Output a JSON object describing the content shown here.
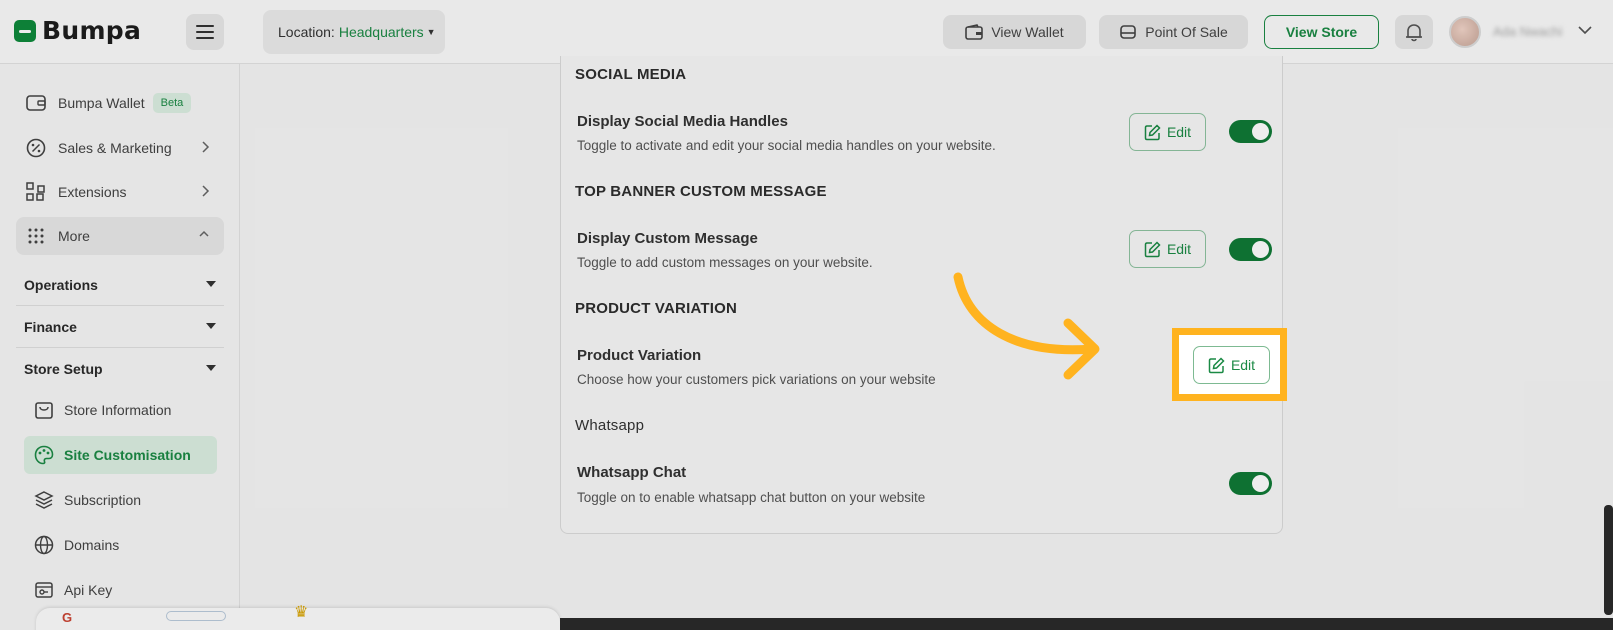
{
  "brand": {
    "name": "Bumpa",
    "accent": "#1b8a45",
    "highlight": "#ffb31f"
  },
  "header": {
    "location_label": "Location:",
    "location_value": "Headquarters",
    "view_wallet": "View Wallet",
    "point_of_sale": "Point Of Sale",
    "view_store": "View Store",
    "user_name": "Ada Nwachi",
    "icons": [
      "menu-icon",
      "wallet-icon",
      "pos-icon",
      "bell-icon",
      "chevron-down-icon"
    ]
  },
  "sidebar": {
    "items": [
      {
        "label": "Bumpa Wallet",
        "badge": "Beta",
        "icon": "wallet-icon"
      },
      {
        "label": "Sales & Marketing",
        "icon": "percent-icon"
      },
      {
        "label": "Extensions",
        "icon": "extensions-icon"
      },
      {
        "label": "More",
        "icon": "grid-icon"
      }
    ],
    "sections": [
      {
        "label": "Operations"
      },
      {
        "label": "Finance"
      },
      {
        "label": "Store Setup"
      }
    ],
    "store_setup_items": [
      {
        "label": "Store Information",
        "icon": "store-icon"
      },
      {
        "label": "Site Customisation",
        "icon": "palette-icon",
        "active": true
      },
      {
        "label": "Subscription",
        "icon": "layers-icon"
      },
      {
        "label": "Domains",
        "icon": "globe-icon"
      },
      {
        "label": "Api Key",
        "icon": "api-key-icon"
      }
    ]
  },
  "settings": {
    "social": {
      "section": "SOCIAL MEDIA",
      "title": "Display Social Media Handles",
      "description": "Toggle to activate and edit your social media handles on your website.",
      "edit": "Edit",
      "enabled": true
    },
    "banner": {
      "section": "TOP BANNER CUSTOM MESSAGE",
      "title": "Display Custom Message",
      "description": "Toggle to add custom messages on your website.",
      "edit": "Edit",
      "enabled": true
    },
    "variation": {
      "section": "PRODUCT VARIATION",
      "title": "Product Variation",
      "description": "Choose how your customers pick variations on your website",
      "edit": "Edit"
    },
    "whatsapp": {
      "section": "Whatsapp",
      "title": "Whatsapp Chat",
      "description": "Toggle on to enable whatsapp chat button on your website",
      "enabled": true
    }
  }
}
